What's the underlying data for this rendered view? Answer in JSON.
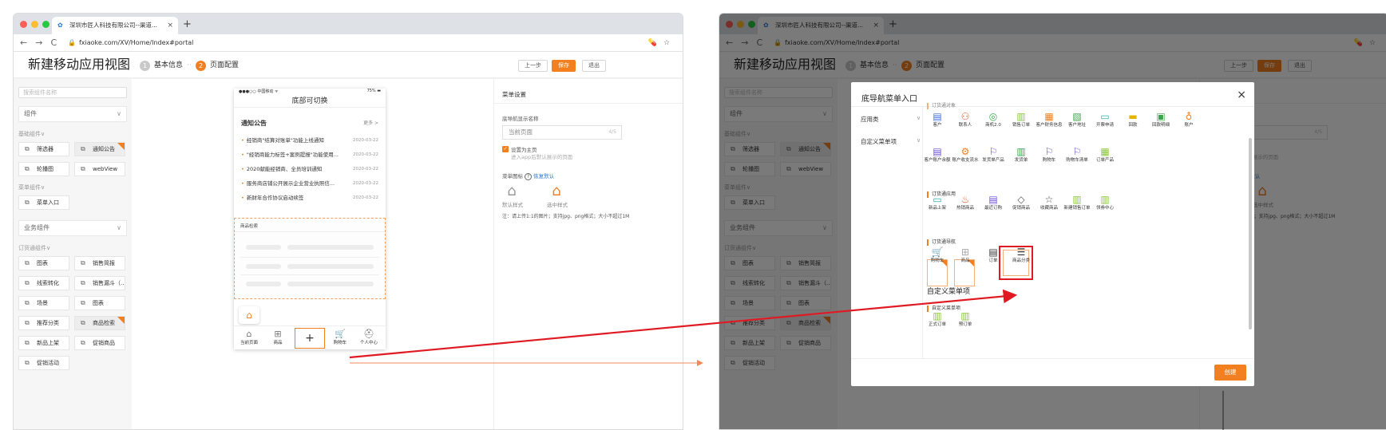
{
  "browser": {
    "tab_title": "深圳市匠人科技有限公司--渠道...",
    "tab_close": "×",
    "new_tab": "+",
    "back": "←",
    "forward": "→",
    "reload": "C",
    "lock": "🔒",
    "url": "fxiaoke.com/XV/Home/Index#portal",
    "ext": "💊",
    "star": "☆"
  },
  "header": {
    "title": "新建移动应用视图",
    "step1_num": "1",
    "step1_label": "基本信息",
    "step_sep": "··",
    "step2_num": "2",
    "step2_label": "页面配置",
    "btn_prev": "上一步",
    "btn_save": "保存",
    "btn_exit": "退出"
  },
  "left": {
    "search_placeholder": "搜索组件名称",
    "sec_components": "组件",
    "grp_basic": "基础组件∨",
    "chips_basic": [
      "筛选器",
      "通知公告",
      "轮播图",
      "webView"
    ],
    "grp_menu": "菜单组件∨",
    "chip_menu": "菜单入口",
    "sec_business": "业务组件",
    "grp_order": "订货通组件∨",
    "chips_order": [
      "图表",
      "销售简报",
      "线索转化",
      "销售漏斗（...",
      "场景",
      "图表",
      "推荐分类",
      "商品检索",
      "新品上架",
      "促销商品",
      "促销活动"
    ]
  },
  "phone": {
    "status_left": "●●●○○ 中国移动 ᯤ",
    "status_right": "75% ▬",
    "title": "底部可切换",
    "announce_title": "通知公告",
    "more": "更多 >",
    "news": [
      {
        "t": "经销商\"结算对账单\"功能上线通知",
        "d": "2020-03-22"
      },
      {
        "t": "\"经销商能力标签+案例提报\"功能使用...",
        "d": "2020-03-22"
      },
      {
        "t": "2020献能经销商、全员培训通知",
        "d": "2020-03-22"
      },
      {
        "t": "服务商店铺公开展示企业营业执照信...",
        "d": "2020-03-22"
      },
      {
        "t": "新财年合作协议启动续签",
        "d": "2020-03-22"
      }
    ],
    "search_label": "商品检索",
    "tabbar": [
      {
        "g": "⌂",
        "l": "当前页面"
      },
      {
        "g": "⊞",
        "l": "商品"
      },
      {
        "g": "🛒",
        "l": "购物车"
      },
      {
        "g": "⛑",
        "l": "个人中心"
      }
    ],
    "plus": "+",
    "home_icon": "⌂"
  },
  "settings": {
    "title": "菜单设置",
    "name_label": "底导航显示名称",
    "name_value": "当前页面",
    "name_count": "4/5",
    "check": "✓",
    "main_label": "设置为主页",
    "main_sub": "进入app后默认展示的页面",
    "icon_label": "菜单图标",
    "help": "?",
    "reset": "恢复默认",
    "default_style": "默认样式",
    "selected_style": "选中样式",
    "note": "注：请上传1:1的图片；支持jpg、png格式；大小不超过1M"
  },
  "modal": {
    "title": "底导航菜单入口",
    "close": "×",
    "side": [
      {
        "l": "应用类",
        "c": "∨"
      },
      {
        "l": "自定义菜单项",
        "c": "∨"
      }
    ],
    "sub_top": "订货通对象",
    "row1": [
      {
        "g": "▤",
        "l": "客户",
        "c": "#3d6fd8"
      },
      {
        "g": "⚇",
        "l": "联系人",
        "c": "#e05a2a"
      },
      {
        "g": "◎",
        "l": "商机2.0",
        "c": "#3aa64c"
      },
      {
        "g": "▥",
        "l": "销售订单",
        "c": "#8cc63f"
      },
      {
        "g": "▦",
        "l": "客户财务信息",
        "c": "#f28020"
      },
      {
        "g": "▧",
        "l": "客户地址",
        "c": "#3aa64c"
      },
      {
        "g": "▭",
        "l": "开票申请",
        "c": "#2ab0b0"
      },
      {
        "g": "▬",
        "l": "回款",
        "c": "#e5b400"
      },
      {
        "g": "▣",
        "l": "回款明细",
        "c": "#3aa64c"
      },
      {
        "g": "♁",
        "l": "账户",
        "c": "#f28020"
      }
    ],
    "row2": [
      {
        "g": "▤",
        "l": "客户账户余额",
        "c": "#6a4fd8"
      },
      {
        "g": "⚙",
        "l": "账户收支流水",
        "c": "#f28020"
      },
      {
        "g": "⚐",
        "l": "发货单产品",
        "c": "#6a4fd8"
      },
      {
        "g": "▥",
        "l": "发货单",
        "c": "#3aa64c"
      },
      {
        "g": "⚐",
        "l": "购物车",
        "c": "#6a4fd8"
      },
      {
        "g": "⚐",
        "l": "购物车清单",
        "c": "#6a4fd8"
      },
      {
        "g": "▦",
        "l": "订单产品",
        "c": "#8cc63f"
      }
    ],
    "sub_app": "订货通应用",
    "row3": [
      {
        "g": "▭",
        "l": "新品上架",
        "c": "#2ab0b0"
      },
      {
        "g": "♨",
        "l": "热销商品",
        "c": "#e05a2a"
      },
      {
        "g": "▤",
        "l": "最近订购",
        "c": "#6a4fd8"
      },
      {
        "g": "◇",
        "l": "促销商品",
        "c": "#555"
      },
      {
        "g": "☆",
        "l": "收藏商品",
        "c": "#555"
      },
      {
        "g": "▥",
        "l": "新建销售订单",
        "c": "#8cc63f"
      },
      {
        "g": "▥",
        "l": "领券中心",
        "c": "#8cc63f"
      }
    ],
    "sub_nav": "订货通导航",
    "row4": [
      {
        "g": "🛒",
        "l": "购物车",
        "c": "#aaa"
      },
      {
        "g": "⊞",
        "l": "商品",
        "c": "#aaa"
      },
      {
        "g": "▤",
        "l": "订单",
        "c": "#333"
      },
      {
        "g": "☰",
        "l": "商品分类",
        "c": "#333"
      }
    ],
    "custom_title": "自定义菜单项",
    "sub_custom": "自定义菜单项",
    "row5": [
      {
        "g": "▥",
        "l": "正式订单",
        "c": "#8cc63f"
      },
      {
        "g": "▥",
        "l": "预订单",
        "c": "#8cc63f"
      }
    ],
    "create": "创建"
  }
}
